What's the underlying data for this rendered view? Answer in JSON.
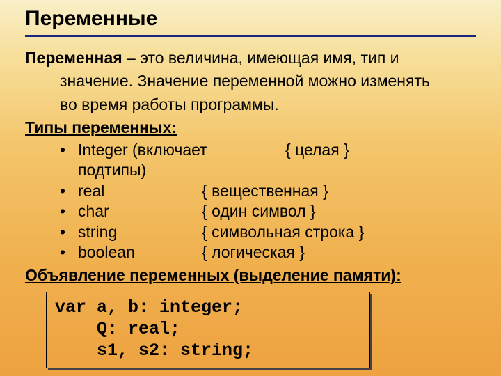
{
  "title": "Переменные",
  "definition": {
    "term": "Переменная",
    "line1": " – это величина, имеющая имя, тип и",
    "line2": "значение. Значение переменной можно изменять",
    "line3": "во время работы программы."
  },
  "types_heading": "Типы переменных:",
  "types": [
    {
      "bullet": "•",
      "name": "Integer (включает подтипы)",
      "note": "{ целая }"
    },
    {
      "bullet": "•",
      "name": "real",
      "note": "{ вещественная }"
    },
    {
      "bullet": "•",
      "name": "char",
      "note": "{ один символ }"
    },
    {
      "bullet": "•",
      "name": "string",
      "note": "{ символьная строка }"
    },
    {
      "bullet": "•",
      "name": "boolean",
      "note": "{ логическая }"
    }
  ],
  "decl_heading": "Объявление переменных (выделение памяти):",
  "code": {
    "l1": "var a, b: integer;",
    "l2": "    Q: real;",
    "l3": "    s1, s2: string;"
  }
}
